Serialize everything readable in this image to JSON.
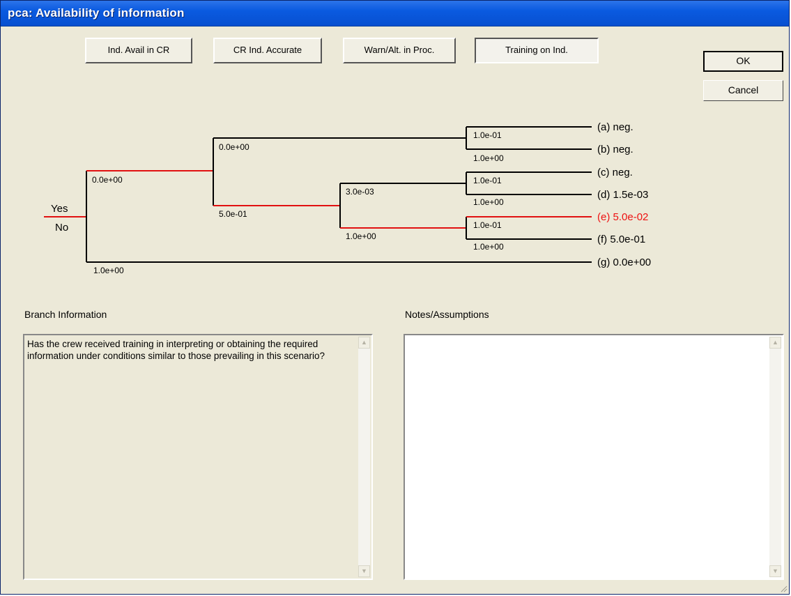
{
  "window": {
    "title": "pca: Availability of information"
  },
  "tabs": [
    {
      "label": "Ind. Avail in CR",
      "active": false
    },
    {
      "label": "CR Ind. Accurate",
      "active": false
    },
    {
      "label": "Warn/Alt. in Proc.",
      "active": false
    },
    {
      "label": "Training on Ind.",
      "active": true
    }
  ],
  "buttons": {
    "ok": "OK",
    "cancel": "Cancel"
  },
  "tree": {
    "root_labels": {
      "yes": "Yes",
      "no": "No"
    },
    "branch_labels": {
      "n1_up": "0.0e+00",
      "n1_down": "1.0e+00",
      "n2_up": "0.0e+00",
      "n2_down": "5.0e-01",
      "n3_up": "3.0e-03",
      "n3_down": "1.0e+00",
      "n4a_up": "1.0e-01",
      "n4a_down": "1.0e+00",
      "n4c_up": "1.0e-01",
      "n4c_down": "1.0e+00",
      "n4e_up": "1.0e-01",
      "n4e_down": "1.0e+00"
    },
    "outcomes": [
      {
        "label": "(a) neg.",
        "highlight": false
      },
      {
        "label": "(b) neg.",
        "highlight": false
      },
      {
        "label": "(c) neg.",
        "highlight": false
      },
      {
        "label": "(d) 1.5e-03",
        "highlight": false
      },
      {
        "label": "(e) 5.0e-02",
        "highlight": true
      },
      {
        "label": "(f) 5.0e-01",
        "highlight": false
      },
      {
        "label": "(g) 0.0e+00",
        "highlight": false
      }
    ],
    "colors": {
      "path": "#000000",
      "selected_path": "#e11010"
    }
  },
  "branch_info": {
    "caption": "Branch Information",
    "text": "Has the crew received training in interpreting or obtaining the required information under conditions similar to those prevailing in this scenario?"
  },
  "notes": {
    "caption": "Notes/Assumptions",
    "text": ""
  }
}
